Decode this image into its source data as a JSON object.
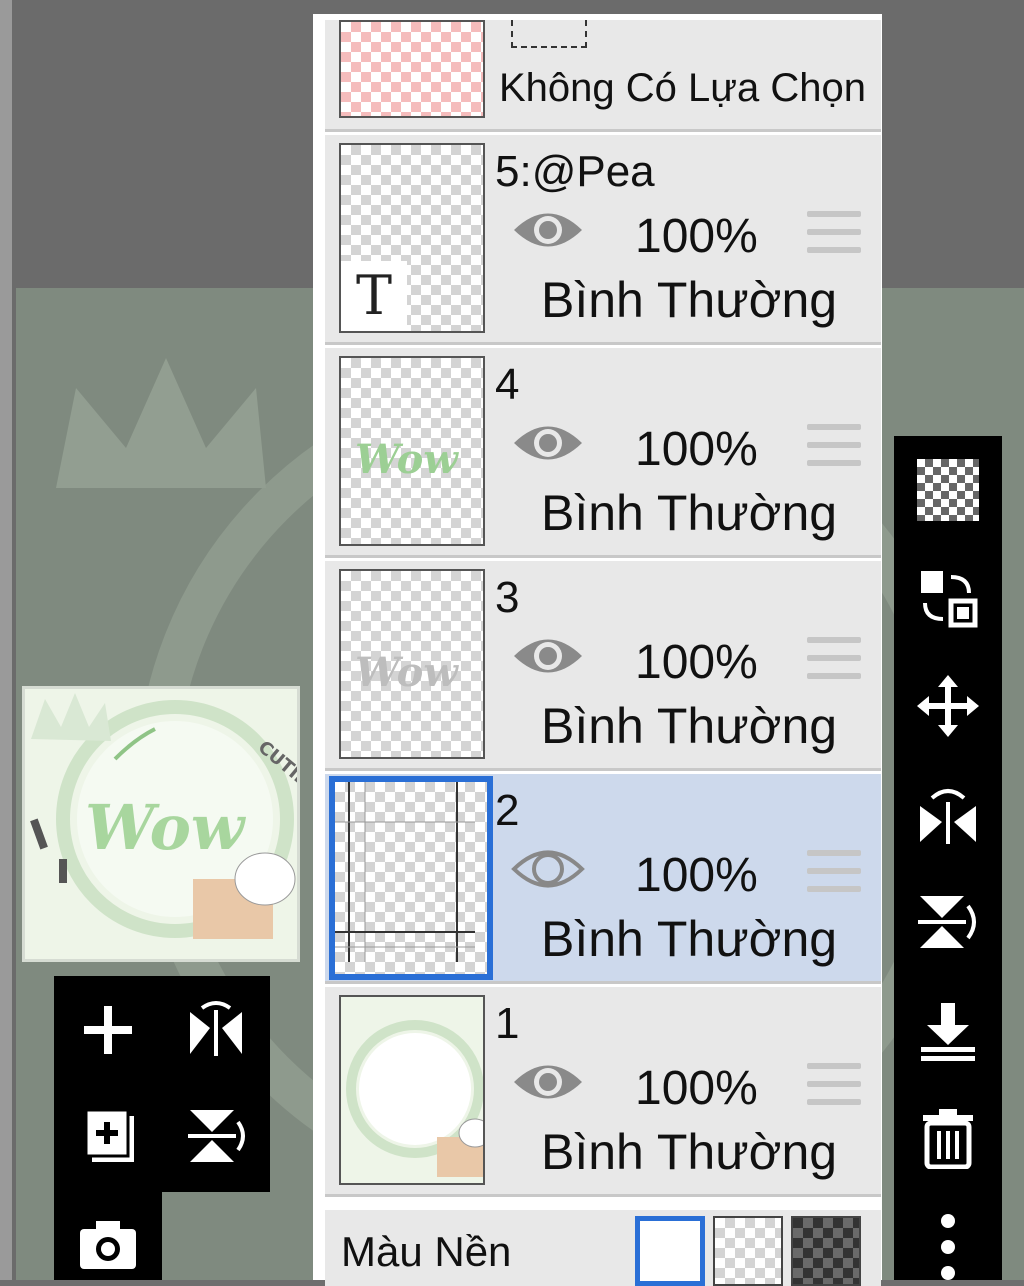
{
  "no_selection_label": "Không Có Lựa Chọn",
  "layers": [
    {
      "name": "5:@Pea",
      "opacity": "100%",
      "blend": "Bình Thường",
      "visible": true,
      "selected": false,
      "type": "text",
      "thumb_glyph": "T"
    },
    {
      "name": "4",
      "opacity": "100%",
      "blend": "Bình Thường",
      "visible": true,
      "selected": false,
      "type": "image",
      "thumb_glyph": "Wow"
    },
    {
      "name": "3",
      "opacity": "100%",
      "blend": "Bình Thường",
      "visible": true,
      "selected": false,
      "type": "image",
      "thumb_glyph": "Wow"
    },
    {
      "name": "2",
      "opacity": "100%",
      "blend": "Bình Thường",
      "visible": true,
      "selected": true,
      "type": "image"
    },
    {
      "name": "1",
      "opacity": "100%",
      "blend": "Bình Thường",
      "visible": true,
      "selected": false,
      "type": "image"
    }
  ],
  "background": {
    "label": "Màu Nền",
    "options": [
      "white",
      "transparent",
      "dark-checker"
    ],
    "selected": "white"
  },
  "preview": {
    "word": "Wow",
    "badge": "CUTIE"
  },
  "left_tools": [
    "add-layer-icon",
    "flip-horizontal-icon",
    "add-copy-icon",
    "flip-vertical-icon",
    "camera-icon"
  ],
  "right_tools": [
    "checker-icon",
    "swap-icon",
    "move-icon",
    "rotate-flip-h-icon",
    "rotate-flip-v-icon",
    "merge-down-icon",
    "trash-icon",
    "more-icon"
  ],
  "colors": {
    "selected_row": "#cdd9ec",
    "selected_border": "#2a6fd6",
    "panel_row": "#e8e8e8",
    "accent_green": "#9ccf94"
  }
}
